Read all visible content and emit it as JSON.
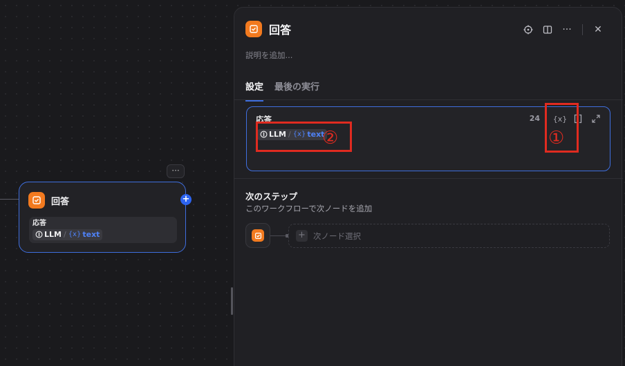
{
  "canvas_node": {
    "title": "回答",
    "body_label": "応答",
    "more_label": "···",
    "plus_label": "+",
    "variable": {
      "source": "LLM",
      "separator": "/",
      "badge": "{x}",
      "name": "text"
    }
  },
  "panel": {
    "title": "回答",
    "description_placeholder": "説明を追加...",
    "actions": {
      "locate": "⌖",
      "docs": "▯▯",
      "more": "···",
      "close": "✕"
    },
    "tabs": [
      {
        "label": "設定",
        "active": true
      },
      {
        "label": "最後の実行",
        "active": false
      }
    ],
    "response": {
      "label": "応答",
      "char_count": "24",
      "variable": {
        "source": "LLM",
        "separator": "/",
        "badge": "{x}",
        "name": "text"
      },
      "tools": {
        "insert_variable": "{x}",
        "bracket": "[ ]",
        "expand": "⤢"
      }
    },
    "next_step": {
      "title": "次のステップ",
      "subtitle": "このワークフローで次ノードを追加",
      "select_placeholder": "次ノード選択",
      "plus_label": "+"
    }
  },
  "annotations": [
    {
      "label": "①"
    },
    {
      "label": "②"
    }
  ],
  "colors": {
    "accent": "#3f6fe0",
    "app_icon": "#f27a1f",
    "annotation": "#e02b20",
    "variable": "#4f82f7"
  }
}
